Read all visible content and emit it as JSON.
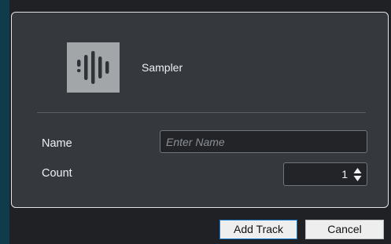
{
  "instrument": {
    "name": "Sampler",
    "icon": "sampler-waveform-icon"
  },
  "form": {
    "name_label": "Name",
    "name_placeholder": "Enter Name",
    "name_value": "",
    "count_label": "Count",
    "count_value": "1"
  },
  "buttons": {
    "add_track": "Add Track",
    "cancel": "Cancel"
  },
  "colors": {
    "panel_bg": "#35393e",
    "panel_border": "#e2e4e6",
    "window_bg": "#1f2124",
    "accent_strip": "#0f3b4a",
    "focus_border": "#1a7ccf",
    "icon_tile": "#a3a6a9"
  }
}
